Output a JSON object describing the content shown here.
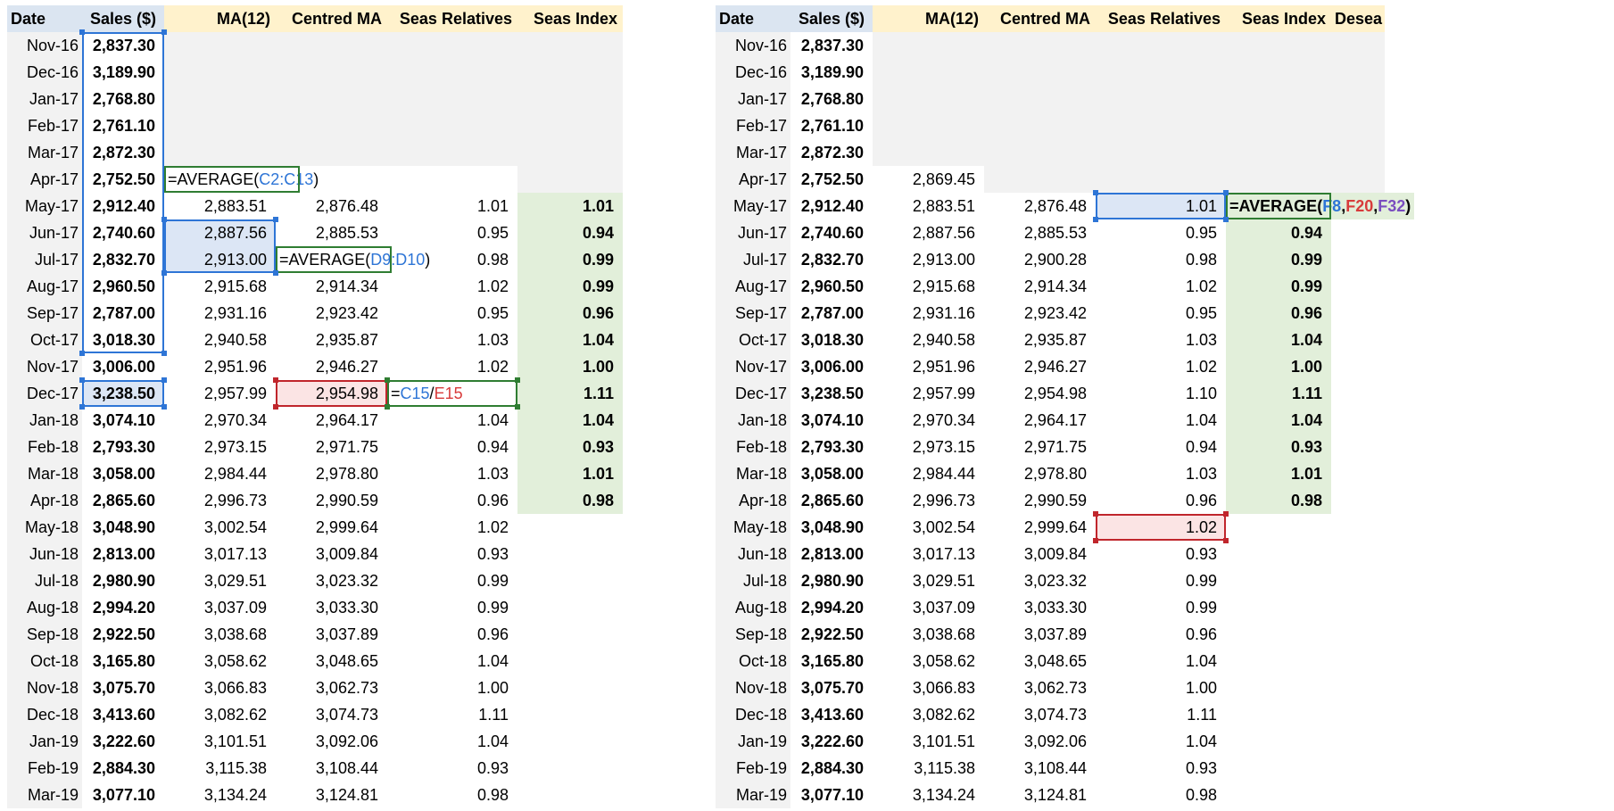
{
  "left": {
    "headers": [
      "Date",
      "Sales ($)",
      "MA(12)",
      "Centred MA",
      "Seas Relatives",
      "Seas Index"
    ],
    "rows": [
      {
        "date": "Nov-16",
        "sales": "2,837.30",
        "ma": "",
        "cma": "",
        "rel": "",
        "idx": ""
      },
      {
        "date": "Dec-16",
        "sales": "3,189.90",
        "ma": "",
        "cma": "",
        "rel": "",
        "idx": ""
      },
      {
        "date": "Jan-17",
        "sales": "2,768.80",
        "ma": "",
        "cma": "",
        "rel": "",
        "idx": ""
      },
      {
        "date": "Feb-17",
        "sales": "2,761.10",
        "ma": "",
        "cma": "",
        "rel": "",
        "idx": ""
      },
      {
        "date": "Mar-17",
        "sales": "2,872.30",
        "ma": "",
        "cma": "",
        "rel": "",
        "idx": ""
      },
      {
        "date": "Apr-17",
        "sales": "2,752.50",
        "ma": "",
        "cma": "",
        "rel": "",
        "idx": ""
      },
      {
        "date": "May-17",
        "sales": "2,912.40",
        "ma": "2,883.51",
        "cma": "2,876.48",
        "rel": "1.01",
        "idx": "1.01"
      },
      {
        "date": "Jun-17",
        "sales": "2,740.60",
        "ma": "2,887.56",
        "cma": "2,885.53",
        "rel": "0.95",
        "idx": "0.94"
      },
      {
        "date": "Jul-17",
        "sales": "2,832.70",
        "ma": "2,913.00",
        "cma": "",
        "rel": "0.98",
        "idx": "0.99"
      },
      {
        "date": "Aug-17",
        "sales": "2,960.50",
        "ma": "2,915.68",
        "cma": "2,914.34",
        "rel": "1.02",
        "idx": "0.99"
      },
      {
        "date": "Sep-17",
        "sales": "2,787.00",
        "ma": "2,931.16",
        "cma": "2,923.42",
        "rel": "0.95",
        "idx": "0.96"
      },
      {
        "date": "Oct-17",
        "sales": "3,018.30",
        "ma": "2,940.58",
        "cma": "2,935.87",
        "rel": "1.03",
        "idx": "1.04"
      },
      {
        "date": "Nov-17",
        "sales": "3,006.00",
        "ma": "2,951.96",
        "cma": "2,946.27",
        "rel": "1.02",
        "idx": "1.00"
      },
      {
        "date": "Dec-17",
        "sales": "3,238.50",
        "ma": "2,957.99",
        "cma": "2,954.98",
        "rel": "",
        "idx": "1.11"
      },
      {
        "date": "Jan-18",
        "sales": "3,074.10",
        "ma": "2,970.34",
        "cma": "2,964.17",
        "rel": "1.04",
        "idx": "1.04"
      },
      {
        "date": "Feb-18",
        "sales": "2,793.30",
        "ma": "2,973.15",
        "cma": "2,971.75",
        "rel": "0.94",
        "idx": "0.93"
      },
      {
        "date": "Mar-18",
        "sales": "3,058.00",
        "ma": "2,984.44",
        "cma": "2,978.80",
        "rel": "1.03",
        "idx": "1.01"
      },
      {
        "date": "Apr-18",
        "sales": "2,865.60",
        "ma": "2,996.73",
        "cma": "2,990.59",
        "rel": "0.96",
        "idx": "0.98"
      },
      {
        "date": "May-18",
        "sales": "3,048.90",
        "ma": "3,002.54",
        "cma": "2,999.64",
        "rel": "1.02",
        "idx": ""
      },
      {
        "date": "Jun-18",
        "sales": "2,813.00",
        "ma": "3,017.13",
        "cma": "3,009.84",
        "rel": "0.93",
        "idx": ""
      },
      {
        "date": "Jul-18",
        "sales": "2,980.90",
        "ma": "3,029.51",
        "cma": "3,023.32",
        "rel": "0.99",
        "idx": ""
      },
      {
        "date": "Aug-18",
        "sales": "2,994.20",
        "ma": "3,037.09",
        "cma": "3,033.30",
        "rel": "0.99",
        "idx": ""
      },
      {
        "date": "Sep-18",
        "sales": "2,922.50",
        "ma": "3,038.68",
        "cma": "3,037.89",
        "rel": "0.96",
        "idx": ""
      },
      {
        "date": "Oct-18",
        "sales": "3,165.80",
        "ma": "3,058.62",
        "cma": "3,048.65",
        "rel": "1.04",
        "idx": ""
      },
      {
        "date": "Nov-18",
        "sales": "3,075.70",
        "ma": "3,066.83",
        "cma": "3,062.73",
        "rel": "1.00",
        "idx": ""
      },
      {
        "date": "Dec-18",
        "sales": "3,413.60",
        "ma": "3,082.62",
        "cma": "3,074.73",
        "rel": "1.11",
        "idx": ""
      },
      {
        "date": "Jan-19",
        "sales": "3,222.60",
        "ma": "3,101.51",
        "cma": "3,092.06",
        "rel": "1.04",
        "idx": ""
      },
      {
        "date": "Feb-19",
        "sales": "2,884.30",
        "ma": "3,115.38",
        "cma": "3,108.44",
        "rel": "0.93",
        "idx": ""
      },
      {
        "date": "Mar-19",
        "sales": "3,077.10",
        "ma": "3,134.24",
        "cma": "3,124.81",
        "rel": "0.98",
        "idx": ""
      }
    ],
    "formulas": {
      "ma_start": [
        {
          "t": "=AVERAGE(",
          "c": ""
        },
        {
          "t": "C2:C13",
          "c": "blue"
        },
        {
          "t": ")",
          "c": ""
        }
      ],
      "cma": [
        {
          "t": "=AVERAGE(",
          "c": ""
        },
        {
          "t": "D9:D10",
          "c": "blue"
        },
        {
          "t": ")",
          "c": ""
        }
      ],
      "rel": [
        {
          "t": "=",
          "c": ""
        },
        {
          "t": "C15",
          "c": "blue"
        },
        {
          "t": "/",
          "c": ""
        },
        {
          "t": "E15",
          "c": "red"
        }
      ]
    }
  },
  "right": {
    "headers": [
      "Date",
      "Sales ($)",
      "MA(12)",
      "Centred MA",
      "Seas Relatives",
      "Seas Index",
      "Desea"
    ],
    "rows": [
      {
        "date": "Nov-16",
        "sales": "2,837.30",
        "ma": "",
        "cma": "",
        "rel": "",
        "idx": ""
      },
      {
        "date": "Dec-16",
        "sales": "3,189.90",
        "ma": "",
        "cma": "",
        "rel": "",
        "idx": ""
      },
      {
        "date": "Jan-17",
        "sales": "2,768.80",
        "ma": "",
        "cma": "",
        "rel": "",
        "idx": ""
      },
      {
        "date": "Feb-17",
        "sales": "2,761.10",
        "ma": "",
        "cma": "",
        "rel": "",
        "idx": ""
      },
      {
        "date": "Mar-17",
        "sales": "2,872.30",
        "ma": "",
        "cma": "",
        "rel": "",
        "idx": ""
      },
      {
        "date": "Apr-17",
        "sales": "2,752.50",
        "ma": "2,869.45",
        "cma": "",
        "rel": "",
        "idx": ""
      },
      {
        "date": "May-17",
        "sales": "2,912.40",
        "ma": "2,883.51",
        "cma": "2,876.48",
        "rel": "1.01",
        "idx": ""
      },
      {
        "date": "Jun-17",
        "sales": "2,740.60",
        "ma": "2,887.56",
        "cma": "2,885.53",
        "rel": "0.95",
        "idx": "0.94"
      },
      {
        "date": "Jul-17",
        "sales": "2,832.70",
        "ma": "2,913.00",
        "cma": "2,900.28",
        "rel": "0.98",
        "idx": "0.99"
      },
      {
        "date": "Aug-17",
        "sales": "2,960.50",
        "ma": "2,915.68",
        "cma": "2,914.34",
        "rel": "1.02",
        "idx": "0.99"
      },
      {
        "date": "Sep-17",
        "sales": "2,787.00",
        "ma": "2,931.16",
        "cma": "2,923.42",
        "rel": "0.95",
        "idx": "0.96"
      },
      {
        "date": "Oct-17",
        "sales": "3,018.30",
        "ma": "2,940.58",
        "cma": "2,935.87",
        "rel": "1.03",
        "idx": "1.04"
      },
      {
        "date": "Nov-17",
        "sales": "3,006.00",
        "ma": "2,951.96",
        "cma": "2,946.27",
        "rel": "1.02",
        "idx": "1.00"
      },
      {
        "date": "Dec-17",
        "sales": "3,238.50",
        "ma": "2,957.99",
        "cma": "2,954.98",
        "rel": "1.10",
        "idx": "1.11"
      },
      {
        "date": "Jan-18",
        "sales": "3,074.10",
        "ma": "2,970.34",
        "cma": "2,964.17",
        "rel": "1.04",
        "idx": "1.04"
      },
      {
        "date": "Feb-18",
        "sales": "2,793.30",
        "ma": "2,973.15",
        "cma": "2,971.75",
        "rel": "0.94",
        "idx": "0.93"
      },
      {
        "date": "Mar-18",
        "sales": "3,058.00",
        "ma": "2,984.44",
        "cma": "2,978.80",
        "rel": "1.03",
        "idx": "1.01"
      },
      {
        "date": "Apr-18",
        "sales": "2,865.60",
        "ma": "2,996.73",
        "cma": "2,990.59",
        "rel": "0.96",
        "idx": "0.98"
      },
      {
        "date": "May-18",
        "sales": "3,048.90",
        "ma": "3,002.54",
        "cma": "2,999.64",
        "rel": "1.02",
        "idx": ""
      },
      {
        "date": "Jun-18",
        "sales": "2,813.00",
        "ma": "3,017.13",
        "cma": "3,009.84",
        "rel": "0.93",
        "idx": ""
      },
      {
        "date": "Jul-18",
        "sales": "2,980.90",
        "ma": "3,029.51",
        "cma": "3,023.32",
        "rel": "0.99",
        "idx": ""
      },
      {
        "date": "Aug-18",
        "sales": "2,994.20",
        "ma": "3,037.09",
        "cma": "3,033.30",
        "rel": "0.99",
        "idx": ""
      },
      {
        "date": "Sep-18",
        "sales": "2,922.50",
        "ma": "3,038.68",
        "cma": "3,037.89",
        "rel": "0.96",
        "idx": ""
      },
      {
        "date": "Oct-18",
        "sales": "3,165.80",
        "ma": "3,058.62",
        "cma": "3,048.65",
        "rel": "1.04",
        "idx": ""
      },
      {
        "date": "Nov-18",
        "sales": "3,075.70",
        "ma": "3,066.83",
        "cma": "3,062.73",
        "rel": "1.00",
        "idx": ""
      },
      {
        "date": "Dec-18",
        "sales": "3,413.60",
        "ma": "3,082.62",
        "cma": "3,074.73",
        "rel": "1.11",
        "idx": ""
      },
      {
        "date": "Jan-19",
        "sales": "3,222.60",
        "ma": "3,101.51",
        "cma": "3,092.06",
        "rel": "1.04",
        "idx": ""
      },
      {
        "date": "Feb-19",
        "sales": "2,884.30",
        "ma": "3,115.38",
        "cma": "3,108.44",
        "rel": "0.93",
        "idx": ""
      },
      {
        "date": "Mar-19",
        "sales": "3,077.10",
        "ma": "3,134.24",
        "cma": "3,124.81",
        "rel": "0.98",
        "idx": ""
      }
    ],
    "formulas": {
      "idx": [
        {
          "t": "=AVERAGE(",
          "c": ""
        },
        {
          "t": "F8",
          "c": "blue"
        },
        {
          "t": ",",
          "c": ""
        },
        {
          "t": "F20",
          "c": "red"
        },
        {
          "t": ",",
          "c": ""
        },
        {
          "t": "F32",
          "c": "purple"
        },
        {
          "t": ")",
          "c": ""
        }
      ]
    }
  },
  "colors": {
    "header_fill": "#fff2cc",
    "date_header_fill": "#dbe5f1",
    "grey_fill": "#f2f2f2",
    "index_fill": "#e2efda",
    "ref_blue": "#2e75d6",
    "ref_red": "#c0262c",
    "edit_green": "#2f7d32"
  }
}
